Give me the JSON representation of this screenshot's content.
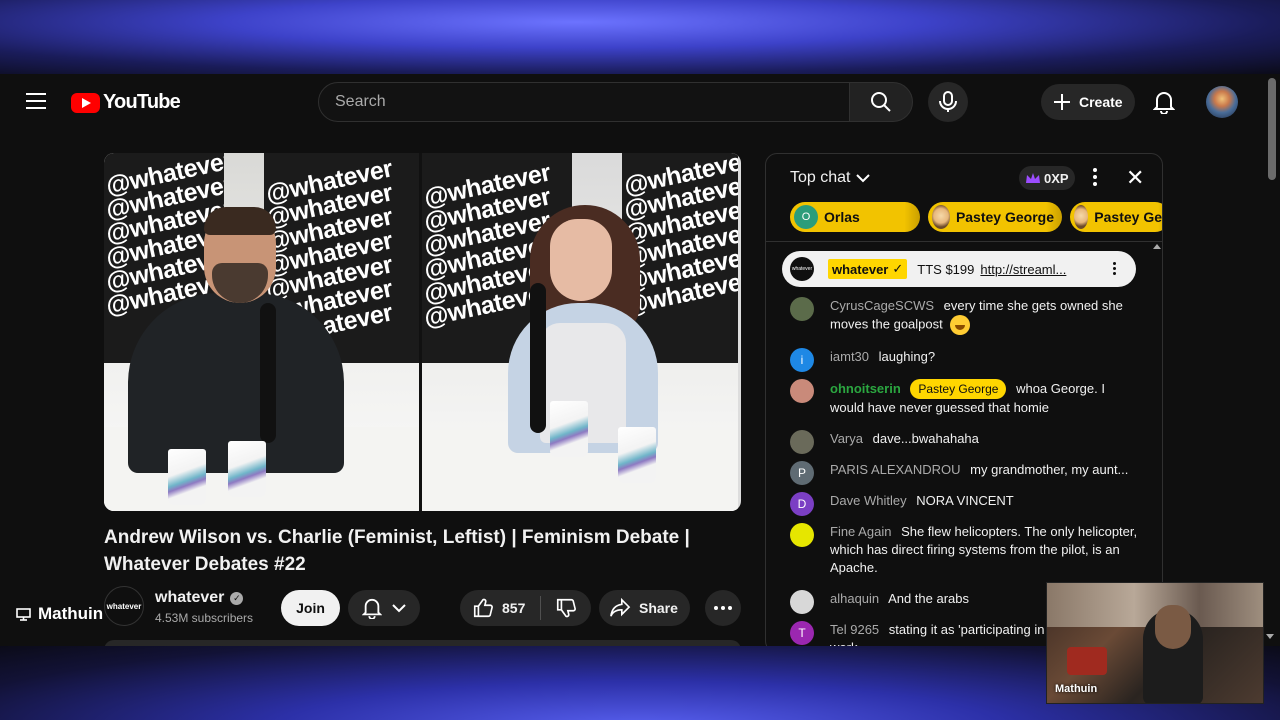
{
  "header": {
    "logo_text": "YouTube",
    "search_placeholder": "Search",
    "create_label": "Create"
  },
  "video": {
    "watermark_lines": [
      "@whatever",
      "@whatever",
      "@whatever",
      "@whatever",
      "@whatever",
      "@whatever",
      "@whatever",
      "@whatever"
    ],
    "title": "Andrew Wilson vs. Charlie (Feminist, Leftist) | Feminism Debate | Whatever Debates #22"
  },
  "channel": {
    "avatar_text": "whatever",
    "name": "whatever",
    "subscribers": "4.53M subscribers",
    "join_label": "Join"
  },
  "actions": {
    "like_count": "857",
    "share_label": "Share"
  },
  "streamer": {
    "name": "Mathuin"
  },
  "chat": {
    "mode_label": "Top chat",
    "xp_label": "0XP",
    "ticker": [
      {
        "avatar": "O",
        "name": "Orlas"
      },
      {
        "avatar": "",
        "name": "Pastey George"
      },
      {
        "avatar": "",
        "name": "Pastey Ge"
      }
    ],
    "pinned": {
      "avatar_text": "whatever",
      "author": "whatever",
      "text": "TTS $199",
      "link": "http://streaml..."
    },
    "messages": [
      {
        "author": "CyrusCageSCWS",
        "text": "every time she gets owned she moves the goalpost",
        "avatar": "",
        "avatar_color": "#5b6b4a"
      },
      {
        "author": "iamt30",
        "text": "laughing?",
        "avatar": "i",
        "avatar_color": "#1e88e5"
      },
      {
        "author": "ohnoitserin",
        "badge": "Pastey George",
        "text": "whoa George. I would have never guessed that homie",
        "avatar": "",
        "avatar_color": "#c98a7a"
      },
      {
        "author": "Varya",
        "text": "dave...bwahahaha",
        "avatar": "",
        "avatar_color": "#6a6a5a"
      },
      {
        "author": "PARIS ALEXANDROU",
        "text": "my grandmother, my aunt...",
        "avatar": "P",
        "avatar_color": "#5f6b73"
      },
      {
        "author": "Dave Whitley",
        "text": "NORA VINCENT",
        "avatar": "D",
        "avatar_color": "#7b3fc4"
      },
      {
        "author": "Fine Again",
        "text": "She flew helicopters. The only helicopter, which has direct firing systems from the pilot, is an Apache.",
        "avatar": "",
        "avatar_color": "#e6e600"
      },
      {
        "author": "alhaquin",
        "text": "And the arabs",
        "avatar": "",
        "avatar_color": "#d8d8d8"
      },
      {
        "author": "Tel 9265",
        "text": "stating it as 'participating in people' is crazy work...",
        "avatar": "T",
        "avatar_color": "#9b27b0"
      }
    ]
  },
  "webcam": {
    "label": "Mathuin"
  },
  "colors": {
    "youtube_red": "#ff0000",
    "super_chat_yellow": "#f2c300",
    "page_bg": "#0f0f0f"
  }
}
